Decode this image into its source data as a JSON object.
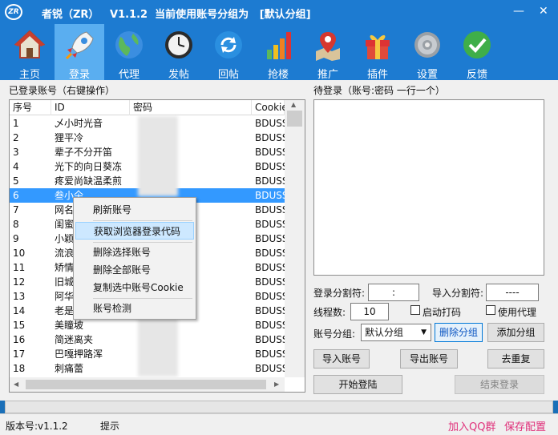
{
  "window": {
    "logo": "ZR",
    "title": "者锐（ZR）   V1.1.2  当前使用账号分组为   [默认分组]",
    "minimize": "—",
    "close": "✕"
  },
  "toolbar": [
    {
      "label": "主页",
      "icon": "home-icon"
    },
    {
      "label": "登录",
      "icon": "rocket-icon",
      "active": true
    },
    {
      "label": "代理",
      "icon": "globe-icon"
    },
    {
      "label": "发帖",
      "icon": "clock-icon"
    },
    {
      "label": "回帖",
      "icon": "refresh-icon"
    },
    {
      "label": "抢楼",
      "icon": "bar-chart-icon"
    },
    {
      "label": "推广",
      "icon": "map-pin-icon"
    },
    {
      "label": "插件",
      "icon": "gift-icon"
    },
    {
      "label": "设置",
      "icon": "gear-icon"
    },
    {
      "label": "反馈",
      "icon": "check-icon"
    }
  ],
  "accounts": {
    "label": "已登录账号（右键操作）",
    "columns": [
      "序号",
      "ID",
      "密码",
      "Cookie"
    ],
    "rows": [
      {
        "no": "1",
        "id": "乄小时光音",
        "cookie": "BDUSS"
      },
      {
        "no": "2",
        "id": "狸平冷",
        "cookie": "BDUSS"
      },
      {
        "no": "3",
        "id": "辈子不分开笛",
        "cookie": "BDUSS"
      },
      {
        "no": "4",
        "id": "光下的向日葵冻",
        "cookie": "BDUSS"
      },
      {
        "no": "5",
        "id": "疼爱尚缺温柔煎",
        "cookie": "BDUSS"
      },
      {
        "no": "6",
        "id": "叁小仐",
        "cookie": "BDUSS"
      },
      {
        "no": "7",
        "id": "网名",
        "cookie": "BDUSS"
      },
      {
        "no": "8",
        "id": "闺蜜",
        "cookie": "BDUSS"
      },
      {
        "no": "9",
        "id": "小颖",
        "cookie": "BDUSS"
      },
      {
        "no": "10",
        "id": "流浪",
        "cookie": "BDUSS"
      },
      {
        "no": "11",
        "id": "矫情",
        "cookie": "BDUSS"
      },
      {
        "no": "12",
        "id": "旧城",
        "cookie": "BDUSS"
      },
      {
        "no": "13",
        "id": "阿华",
        "cookie": "BDUSS"
      },
      {
        "no": "14",
        "id": "老是",
        "cookie": "BDUSS"
      },
      {
        "no": "15",
        "id": "美瞳坡",
        "cookie": "BDUSS"
      },
      {
        "no": "16",
        "id": "简迷离夹",
        "cookie": "BDUSS"
      },
      {
        "no": "17",
        "id": "巴嘎押路浑",
        "cookie": "BDUSS"
      },
      {
        "no": "18",
        "id": "刺痛蕾",
        "cookie": "BDUSS"
      }
    ],
    "selected_row": 6
  },
  "context_menu": {
    "items": [
      "刷新账号",
      "获取浏览器登录代码",
      "删除选择账号",
      "删除全部账号",
      "复制选中账号Cookie",
      "账号检测"
    ],
    "highlighted": 1
  },
  "pending": {
    "label": "待登录（账号:密码 一行一个）",
    "login_sep_label": "登录分割符:",
    "login_sep_value": ":",
    "import_sep_label": "导入分割符:",
    "import_sep_value": "----",
    "threads_label": "线程数:",
    "threads_value": "10",
    "captcha_label": "启动打码",
    "proxy_label": "使用代理",
    "group_label": "账号分组:",
    "group_value": "默认分组",
    "delete_group": "删除分组",
    "add_group": "添加分组",
    "import_btn": "导入账号",
    "export_btn": "导出账号",
    "dedupe_btn": "去重复",
    "start_btn": "开始登陆",
    "stop_btn": "结束登录"
  },
  "status": {
    "version": "版本号:v1.1.2",
    "hint": "提示",
    "join_qq": "加入QQ群",
    "save_config": "保存配置"
  },
  "colors": {
    "titlebar": "#1d7bd1",
    "toolbar_active": "#5aaef0",
    "selection": "#3399ff",
    "link": "#e0307a"
  }
}
